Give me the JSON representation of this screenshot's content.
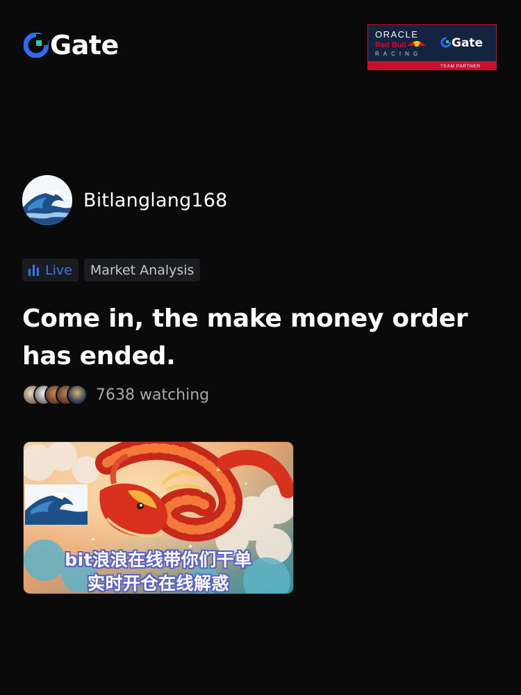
{
  "header": {
    "brand_name": "Gate",
    "partner": {
      "line1": "ORACLE",
      "line2": "Red Bull",
      "line3": "RACING",
      "brand": "Gate",
      "tag": "TEAM PARTNER"
    }
  },
  "author": {
    "name": "Bitlanglang168"
  },
  "tags": {
    "live": "Live",
    "topic": "Market Analysis"
  },
  "title": "Come in, the make money order has ended.",
  "watchers": {
    "count_text": "7638 watching"
  },
  "thumbnail": {
    "caption_line1": "bit浪浪在线带你们干单",
    "caption_line2": "实时开仓在线解惑"
  },
  "colors": {
    "accent_blue": "#2f7cf6",
    "background": "#0a0a0b",
    "tag_bg": "#1b1c1f",
    "partner_border": "#c8102e"
  }
}
